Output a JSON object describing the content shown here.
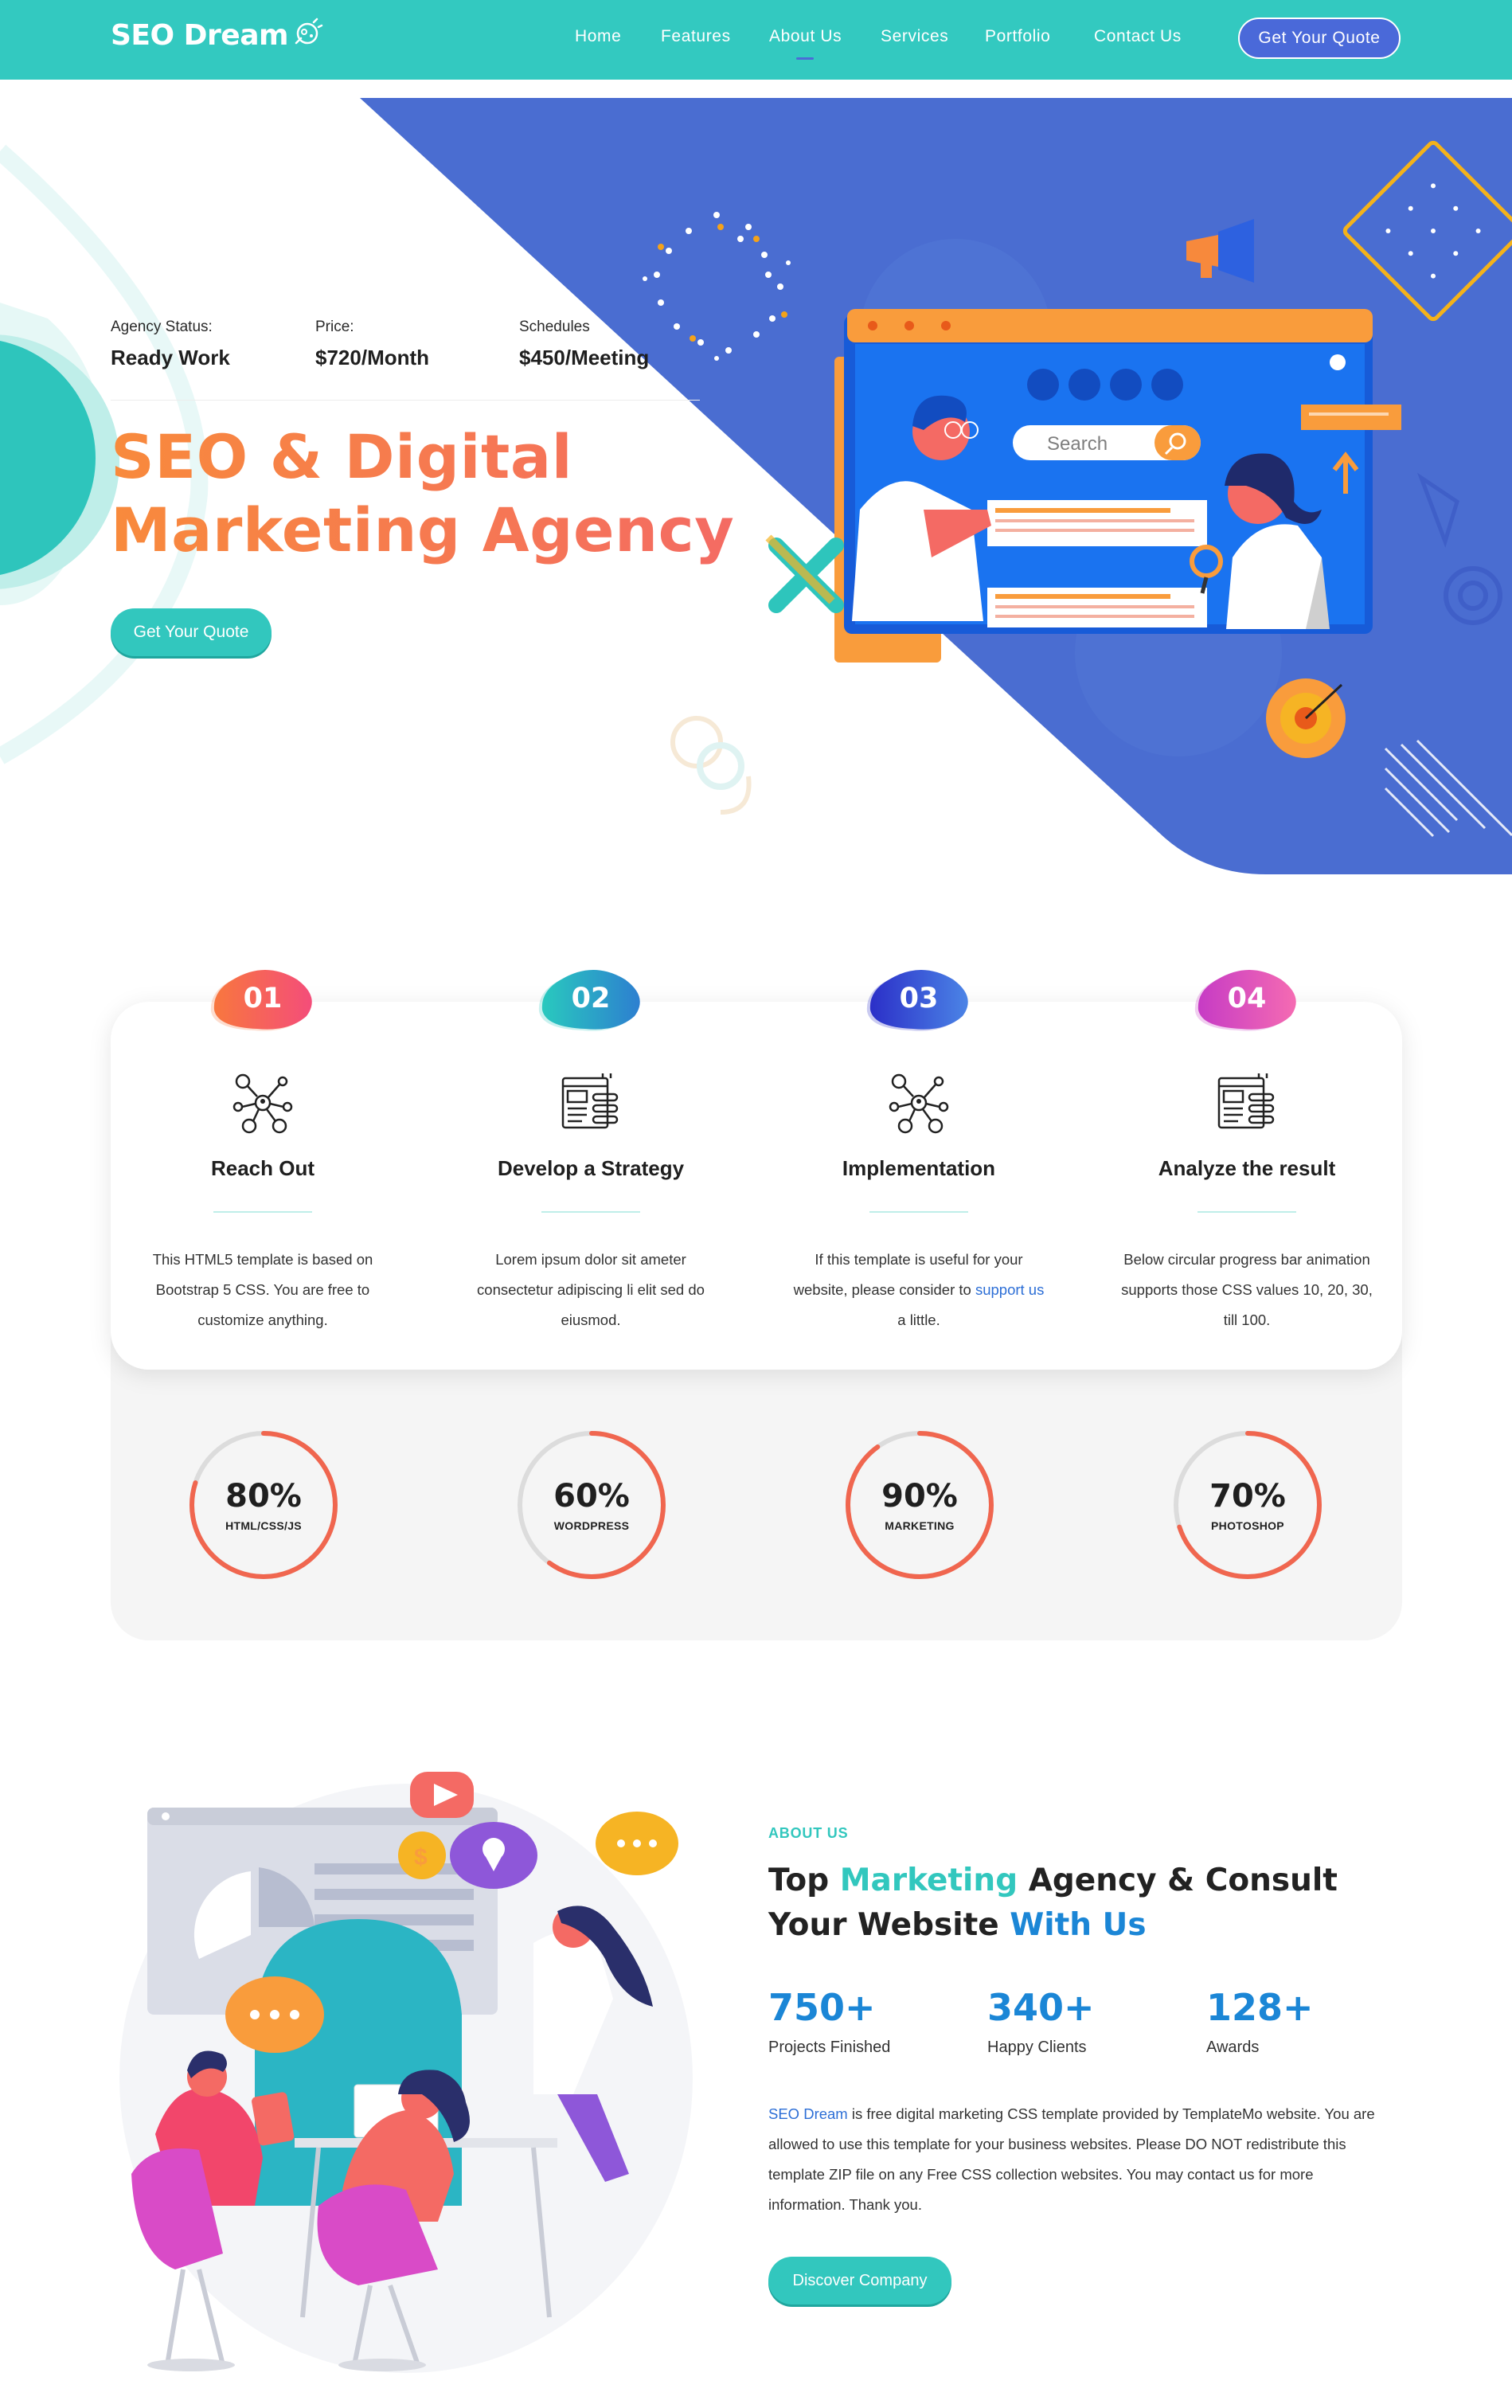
{
  "header": {
    "logo": "SEO Dream",
    "nav": [
      "Home",
      "Features",
      "About Us",
      "Services",
      "Portfolio",
      "Contact Us"
    ],
    "active_nav": "About Us",
    "quote_button": "Get Your Quote"
  },
  "hero": {
    "stats": [
      {
        "label": "Agency Status:",
        "value": "Ready Work"
      },
      {
        "label": "Price:",
        "value": "$720/Month"
      },
      {
        "label": "Schedules",
        "value": "$450/Meeting"
      }
    ],
    "title_line1": "SEO & Digital",
    "title_line2": "Marketing Agency",
    "button": "Get Your Quote",
    "illustration": {
      "search_placeholder": "Search"
    }
  },
  "features": [
    {
      "number": "01",
      "icon": "network-people-icon",
      "title": "Reach Out",
      "desc": "This HTML5 template is based on Bootstrap 5 CSS. You are free to customize anything.",
      "badge_colors": [
        "#f8773e",
        "#f44d7a"
      ]
    },
    {
      "number": "02",
      "icon": "browser-window-icon",
      "title": "Develop a Strategy",
      "desc": "Lorem ipsum dolor sit ameter consectetur adipiscing li elit sed do eiusmod.",
      "badge_colors": [
        "#29c9be",
        "#2d7fd0"
      ]
    },
    {
      "number": "03",
      "icon": "network-people-icon",
      "title": "Implementation",
      "desc_before": "If this template is useful for your website, please consider to ",
      "desc_link": "support us",
      "desc_after": " a little.",
      "badge_colors": [
        "#2b2fc8",
        "#4b84e6"
      ]
    },
    {
      "number": "04",
      "icon": "browser-window-icon",
      "title": "Analyze the result",
      "desc": "Below circular progress bar animation supports those CSS values 10, 20, 30, till 100.",
      "badge_colors": [
        "#c63bc5",
        "#f56bb2"
      ]
    }
  ],
  "progress": [
    {
      "value": "80%",
      "fraction": 0.8,
      "label": "HTML/CSS/JS"
    },
    {
      "value": "60%",
      "fraction": 0.6,
      "label": "WORDPRESS"
    },
    {
      "value": "90%",
      "fraction": 0.9,
      "label": "MARKETING"
    },
    {
      "value": "70%",
      "fraction": 0.7,
      "label": "PHOTOSHOP"
    }
  ],
  "about": {
    "kicker": "ABOUT US",
    "title_parts": [
      "Top ",
      "Marketing",
      " Agency & Consult Your Website ",
      "With Us"
    ],
    "counters": [
      {
        "value": "750+",
        "label": "Projects Finished"
      },
      {
        "value": "340+",
        "label": "Happy Clients"
      },
      {
        "value": "128+",
        "label": "Awards"
      }
    ],
    "desc_link": "SEO Dream",
    "desc": " is free digital marketing CSS template provided by TemplateMo website. You are allowed to use this template for your business websites. Please DO NOT redistribute this template ZIP file on any Free CSS collection websites. You may contact us for more information. Thank you.",
    "button": "Discover Company"
  },
  "colors": {
    "teal": "#33c9c0",
    "blue": "#4a69d9",
    "orange": "#f88a3c",
    "ring": "#f0664f",
    "counter_blue": "#1b86d6"
  }
}
